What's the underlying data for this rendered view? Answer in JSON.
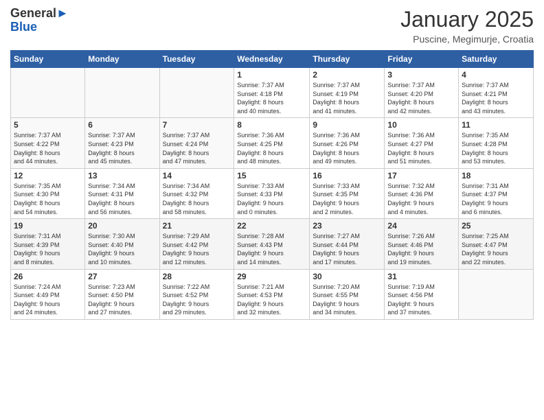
{
  "header": {
    "logo": {
      "general": "General",
      "blue": "Blue"
    },
    "title": "January 2025",
    "location": "Puscine, Megimurje, Croatia"
  },
  "days_of_week": [
    "Sunday",
    "Monday",
    "Tuesday",
    "Wednesday",
    "Thursday",
    "Friday",
    "Saturday"
  ],
  "weeks": [
    [
      {
        "day": "",
        "info": ""
      },
      {
        "day": "",
        "info": ""
      },
      {
        "day": "",
        "info": ""
      },
      {
        "day": "1",
        "info": "Sunrise: 7:37 AM\nSunset: 4:18 PM\nDaylight: 8 hours\nand 40 minutes."
      },
      {
        "day": "2",
        "info": "Sunrise: 7:37 AM\nSunset: 4:19 PM\nDaylight: 8 hours\nand 41 minutes."
      },
      {
        "day": "3",
        "info": "Sunrise: 7:37 AM\nSunset: 4:20 PM\nDaylight: 8 hours\nand 42 minutes."
      },
      {
        "day": "4",
        "info": "Sunrise: 7:37 AM\nSunset: 4:21 PM\nDaylight: 8 hours\nand 43 minutes."
      }
    ],
    [
      {
        "day": "5",
        "info": "Sunrise: 7:37 AM\nSunset: 4:22 PM\nDaylight: 8 hours\nand 44 minutes."
      },
      {
        "day": "6",
        "info": "Sunrise: 7:37 AM\nSunset: 4:23 PM\nDaylight: 8 hours\nand 45 minutes."
      },
      {
        "day": "7",
        "info": "Sunrise: 7:37 AM\nSunset: 4:24 PM\nDaylight: 8 hours\nand 47 minutes."
      },
      {
        "day": "8",
        "info": "Sunrise: 7:36 AM\nSunset: 4:25 PM\nDaylight: 8 hours\nand 48 minutes."
      },
      {
        "day": "9",
        "info": "Sunrise: 7:36 AM\nSunset: 4:26 PM\nDaylight: 8 hours\nand 49 minutes."
      },
      {
        "day": "10",
        "info": "Sunrise: 7:36 AM\nSunset: 4:27 PM\nDaylight: 8 hours\nand 51 minutes."
      },
      {
        "day": "11",
        "info": "Sunrise: 7:35 AM\nSunset: 4:28 PM\nDaylight: 8 hours\nand 53 minutes."
      }
    ],
    [
      {
        "day": "12",
        "info": "Sunrise: 7:35 AM\nSunset: 4:30 PM\nDaylight: 8 hours\nand 54 minutes."
      },
      {
        "day": "13",
        "info": "Sunrise: 7:34 AM\nSunset: 4:31 PM\nDaylight: 8 hours\nand 56 minutes."
      },
      {
        "day": "14",
        "info": "Sunrise: 7:34 AM\nSunset: 4:32 PM\nDaylight: 8 hours\nand 58 minutes."
      },
      {
        "day": "15",
        "info": "Sunrise: 7:33 AM\nSunset: 4:33 PM\nDaylight: 9 hours\nand 0 minutes."
      },
      {
        "day": "16",
        "info": "Sunrise: 7:33 AM\nSunset: 4:35 PM\nDaylight: 9 hours\nand 2 minutes."
      },
      {
        "day": "17",
        "info": "Sunrise: 7:32 AM\nSunset: 4:36 PM\nDaylight: 9 hours\nand 4 minutes."
      },
      {
        "day": "18",
        "info": "Sunrise: 7:31 AM\nSunset: 4:37 PM\nDaylight: 9 hours\nand 6 minutes."
      }
    ],
    [
      {
        "day": "19",
        "info": "Sunrise: 7:31 AM\nSunset: 4:39 PM\nDaylight: 9 hours\nand 8 minutes."
      },
      {
        "day": "20",
        "info": "Sunrise: 7:30 AM\nSunset: 4:40 PM\nDaylight: 9 hours\nand 10 minutes."
      },
      {
        "day": "21",
        "info": "Sunrise: 7:29 AM\nSunset: 4:42 PM\nDaylight: 9 hours\nand 12 minutes."
      },
      {
        "day": "22",
        "info": "Sunrise: 7:28 AM\nSunset: 4:43 PM\nDaylight: 9 hours\nand 14 minutes."
      },
      {
        "day": "23",
        "info": "Sunrise: 7:27 AM\nSunset: 4:44 PM\nDaylight: 9 hours\nand 17 minutes."
      },
      {
        "day": "24",
        "info": "Sunrise: 7:26 AM\nSunset: 4:46 PM\nDaylight: 9 hours\nand 19 minutes."
      },
      {
        "day": "25",
        "info": "Sunrise: 7:25 AM\nSunset: 4:47 PM\nDaylight: 9 hours\nand 22 minutes."
      }
    ],
    [
      {
        "day": "26",
        "info": "Sunrise: 7:24 AM\nSunset: 4:49 PM\nDaylight: 9 hours\nand 24 minutes."
      },
      {
        "day": "27",
        "info": "Sunrise: 7:23 AM\nSunset: 4:50 PM\nDaylight: 9 hours\nand 27 minutes."
      },
      {
        "day": "28",
        "info": "Sunrise: 7:22 AM\nSunset: 4:52 PM\nDaylight: 9 hours\nand 29 minutes."
      },
      {
        "day": "29",
        "info": "Sunrise: 7:21 AM\nSunset: 4:53 PM\nDaylight: 9 hours\nand 32 minutes."
      },
      {
        "day": "30",
        "info": "Sunrise: 7:20 AM\nSunset: 4:55 PM\nDaylight: 9 hours\nand 34 minutes."
      },
      {
        "day": "31",
        "info": "Sunrise: 7:19 AM\nSunset: 4:56 PM\nDaylight: 9 hours\nand 37 minutes."
      },
      {
        "day": "",
        "info": ""
      }
    ]
  ]
}
